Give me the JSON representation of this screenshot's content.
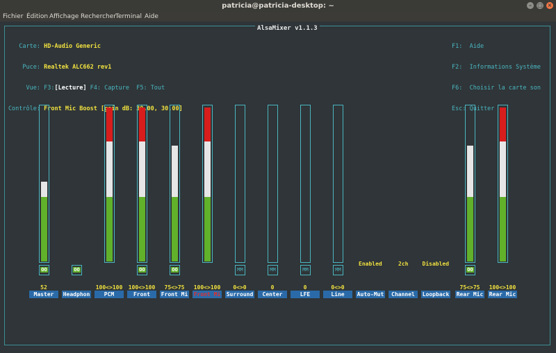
{
  "window": {
    "title": "patricia@patricia-desktop: ~",
    "close_glyph": "×",
    "min_glyph": "–",
    "max_glyph": "□"
  },
  "menu": [
    "Fichier",
    "Édition",
    "Affichage",
    "Rechercher",
    "Terminal",
    "Aide"
  ],
  "app_title": "AlsaMixer v1.1.3",
  "info": {
    "carte_label": "Carte:",
    "carte": "HD-Audio Generic",
    "puce_label": "Puce:",
    "puce": "Realtek ALC662 rev1",
    "vue_label": "Vue:",
    "vue_f3": "F3:",
    "vue_lecture": "[Lecture]",
    "vue_f4": "F4: Capture",
    "vue_f5": "F5: Tout",
    "controle_label": "Contrôle:",
    "controle": "Front Mic Boost [gain dB: 30,00, 30,00]"
  },
  "help": {
    "f1": "F1:  Aide",
    "f2": "F2:  Informations Système",
    "f6": "F6:  Choisir la carte son",
    "esc": "Esc: Quitter"
  },
  "channels": [
    {
      "name": "Master",
      "level": "52",
      "mute": "OO",
      "level_pct": 52,
      "has_bar": true
    },
    {
      "name": "Headphon",
      "level": "",
      "mute": "OO",
      "has_bar": false
    },
    {
      "name": "PCM",
      "level": "100<>100",
      "mute": "",
      "level_pct": 100,
      "has_bar": true
    },
    {
      "name": "Front",
      "level": "100<>100",
      "mute": "OO",
      "level_pct": 100,
      "has_bar": true
    },
    {
      "name": "Front Mi",
      "level": "75<>75",
      "mute": "OO",
      "level_pct": 75,
      "has_bar": true
    },
    {
      "name": "Front Mi",
      "level": "100<>100",
      "mute": "",
      "level_pct": 100,
      "has_bar": true,
      "active": true
    },
    {
      "name": "Surround",
      "level": "0<>0",
      "mute": "MM",
      "level_pct": 0,
      "has_bar": true
    },
    {
      "name": "Center",
      "level": "0",
      "mute": "MM",
      "level_pct": 0,
      "has_bar": true
    },
    {
      "name": "LFE",
      "level": "0",
      "mute": "MM",
      "level_pct": 0,
      "has_bar": true
    },
    {
      "name": "Line",
      "level": "0<>0",
      "mute": "MM",
      "level_pct": 0,
      "has_bar": true
    },
    {
      "name": "Auto-Mut",
      "level": "",
      "enum": "Enabled",
      "has_bar": false
    },
    {
      "name": "Channel",
      "level": "",
      "enum": "2ch",
      "has_bar": false
    },
    {
      "name": "Loopback",
      "level": "",
      "enum": "Disabled",
      "has_bar": false
    },
    {
      "name": "Rear Mic",
      "level": "75<>75",
      "mute": "OO",
      "level_pct": 75,
      "has_bar": true
    },
    {
      "name": "Rear Mic",
      "level": "100<>100",
      "mute": "",
      "level_pct": 100,
      "has_bar": true
    }
  ],
  "colors": {
    "green": "#61b12b",
    "white": "#e6e6e6",
    "red": "#d81d1d",
    "frame": "#4bb6c2",
    "label_bg": "#2a6aa8"
  }
}
